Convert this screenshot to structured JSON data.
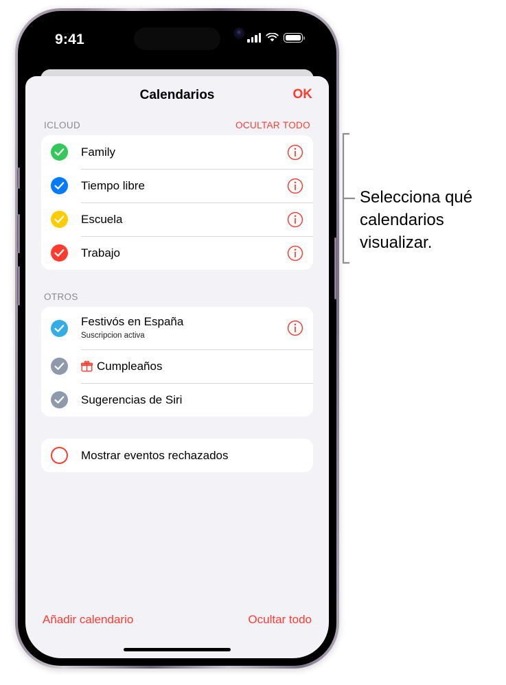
{
  "statusbar": {
    "time": "9:41",
    "signal_icon": "cellular-bars-icon",
    "wifi_icon": "wifi-icon",
    "battery_icon": "battery-icon"
  },
  "sheet": {
    "title": "Calendarios",
    "done_label": "OK"
  },
  "sections": [
    {
      "label": "ICLOUD",
      "action_label": "OCULTAR TODO",
      "rows": [
        {
          "title": "Family",
          "checked": true,
          "color": "#34c759",
          "info": true
        },
        {
          "title": "Tiempo libre",
          "checked": true,
          "color": "#007aff",
          "info": true
        },
        {
          "title": "Escuela",
          "checked": true,
          "color": "#ffcc00",
          "info": true
        },
        {
          "title": "Trabajo",
          "checked": true,
          "color": "#ff3b30",
          "info": true
        }
      ]
    },
    {
      "label": "OTROS",
      "action_label": "",
      "rows": [
        {
          "title": "Festivós en España",
          "subtitle": "Suscripcion activa",
          "checked": true,
          "color": "#32ade6",
          "info": true
        },
        {
          "title": "Cumpleaños",
          "checked": true,
          "color": "#8e99ab",
          "info": false,
          "icon": "gift-icon"
        },
        {
          "title": "Sugerencias de Siri",
          "checked": true,
          "color": "#8e99ab",
          "info": false
        }
      ]
    }
  ],
  "rejected": {
    "label": "Mostrar eventos rechazados",
    "checked": false,
    "ring_color": "#ff3b30"
  },
  "footer": {
    "add_calendar_label": "Añadir calendario",
    "hide_all_label": "Ocultar todo"
  },
  "callout": {
    "text": "Selecciona qué calendarios visualizar."
  },
  "colors": {
    "accent_red": "#ff3b30",
    "sheet_bg": "#f2f2f7",
    "card_bg": "#ffffff",
    "section_label": "#8a8a8e"
  }
}
